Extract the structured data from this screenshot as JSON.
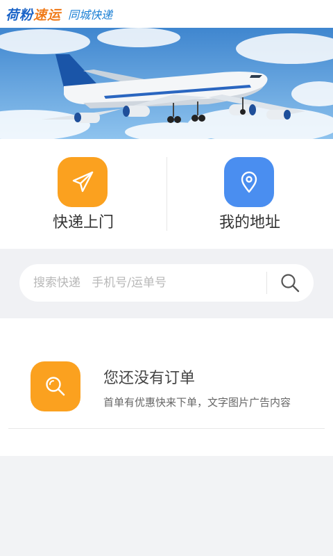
{
  "header": {
    "logo_part1": "荷粉",
    "logo_part2": "速运",
    "slogan": "同城快递"
  },
  "banner": {
    "image": "airplane-in-sky"
  },
  "actions": [
    {
      "label": "快递上门",
      "icon": "paper-plane-icon",
      "color": "#fba11f"
    },
    {
      "label": "我的地址",
      "icon": "location-pin-icon",
      "color": "#4a8ef0"
    }
  ],
  "search": {
    "placeholder": "搜索快递   手机号/运单号",
    "icon": "search-icon"
  },
  "orders": {
    "empty_title": "您还没有订单",
    "empty_subtitle": "首单有优惠快来下单，文字图片广告内容",
    "icon": "search-icon",
    "icon_color": "#fba11f"
  },
  "colors": {
    "brand_blue": "#1a63c7",
    "brand_orange": "#f07b1a",
    "accent_orange": "#fba11f",
    "accent_blue": "#4a8ef0",
    "background": "#f2f3f5"
  }
}
